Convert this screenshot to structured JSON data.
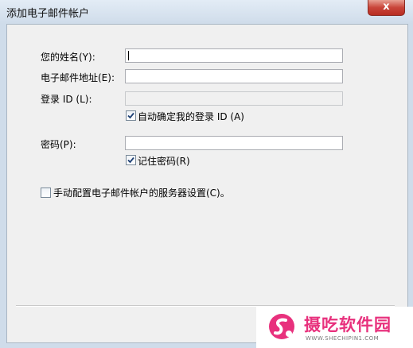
{
  "window": {
    "title": "添加电子邮件帐户",
    "close_glyph": "x"
  },
  "form": {
    "name_label": "您的姓名(Y):",
    "name_value": "",
    "email_label": "电子邮件地址(E):",
    "email_value": "",
    "login_label": "登录 ID (L):",
    "login_value": "",
    "auto_login_label": "自动确定我的登录 ID (A)",
    "auto_login_checked": true,
    "password_label": "密码(P):",
    "password_value": "",
    "remember_label": "记住密码(R)",
    "remember_checked": true,
    "manual_label": "手动配置电子邮件帐户的服务器设置(C)。",
    "manual_checked": false
  },
  "watermark": {
    "text": "摄吃软件园",
    "url": "WWW.SHECHIPIN1.COM",
    "color": "#e8317d"
  }
}
